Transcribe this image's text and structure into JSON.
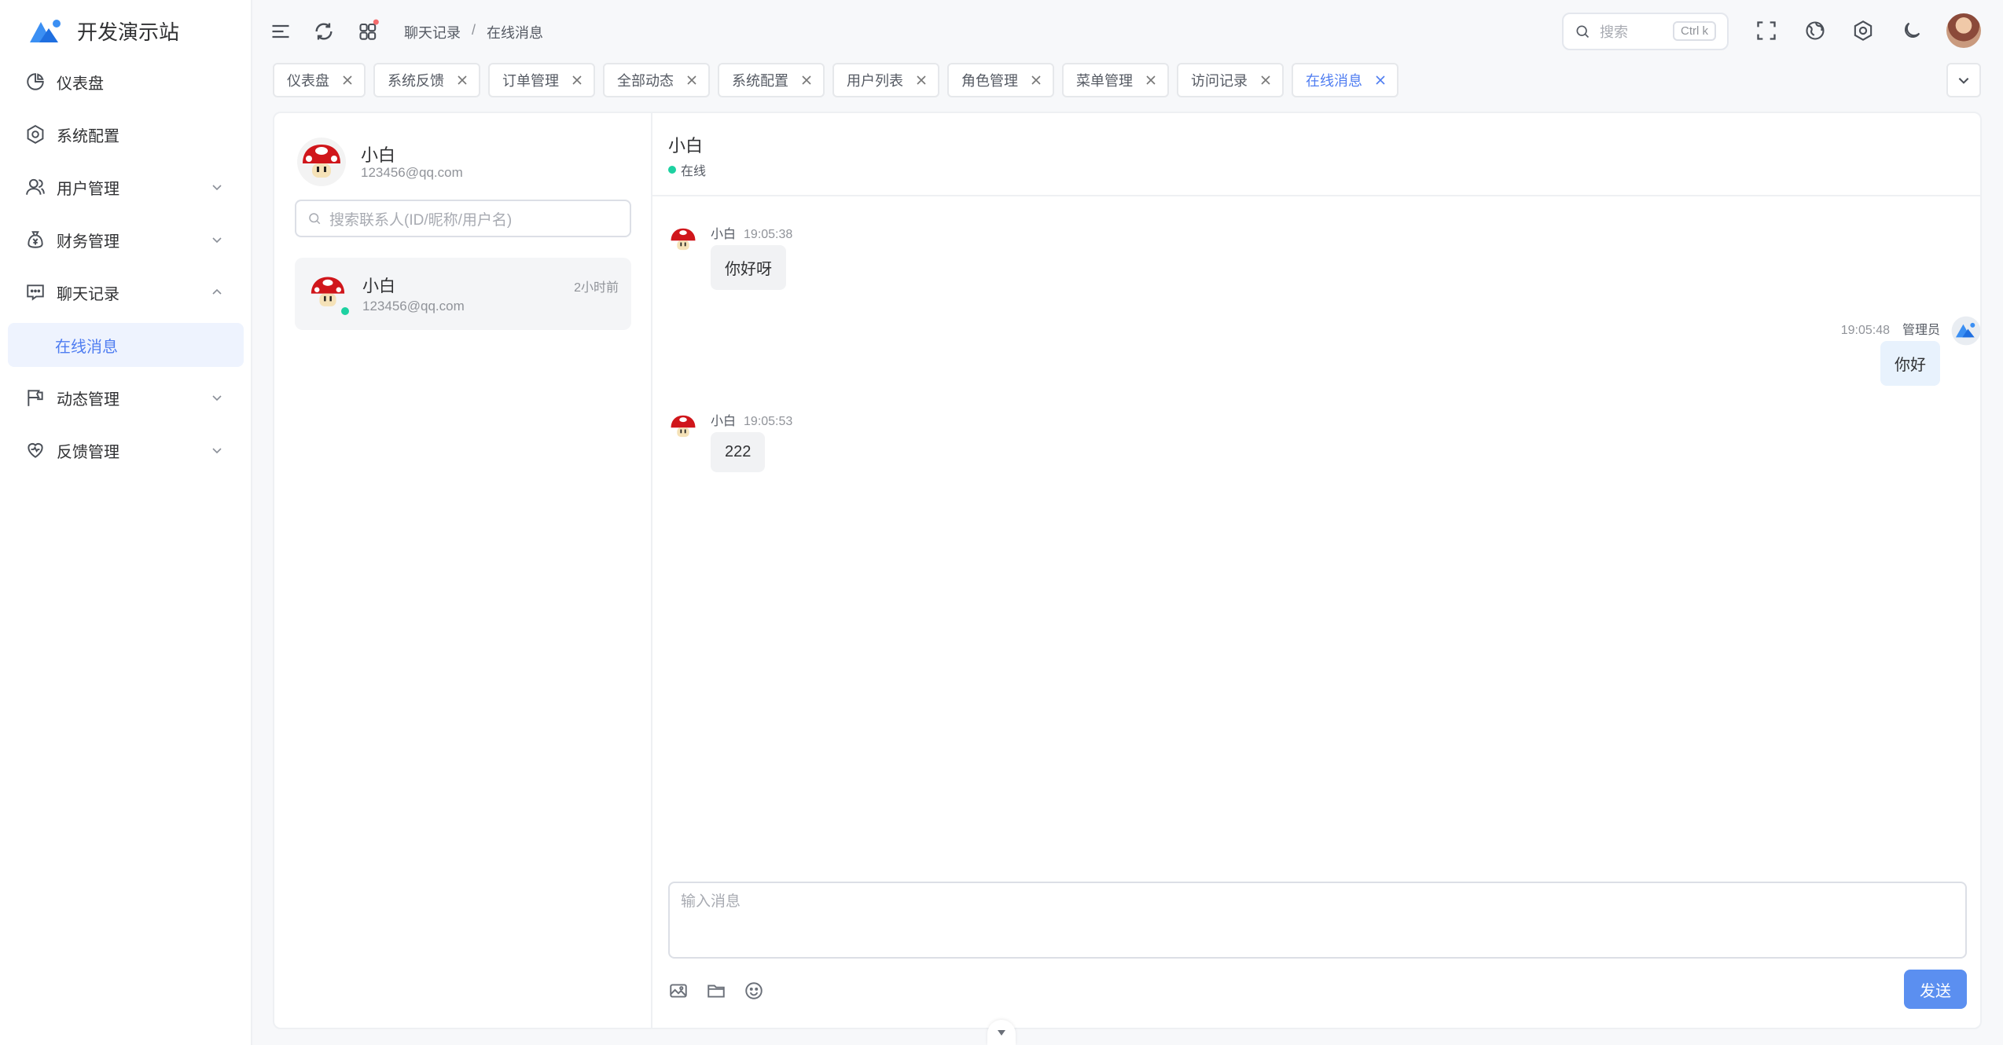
{
  "app": {
    "title": "开发演示站"
  },
  "sidebar": {
    "items": [
      {
        "label": "仪表盘",
        "icon": "pie-chart-icon"
      },
      {
        "label": "系统配置",
        "icon": "gear-icon"
      },
      {
        "label": "用户管理",
        "icon": "user-icon"
      },
      {
        "label": "财务管理",
        "icon": "money-bag-icon"
      },
      {
        "label": "聊天记录",
        "icon": "chat-icon"
      },
      {
        "label": "在线消息",
        "icon": ""
      },
      {
        "label": "动态管理",
        "icon": "flag-icon"
      },
      {
        "label": "反馈管理",
        "icon": "heart-icon"
      }
    ],
    "active_color": "#4f7df1"
  },
  "breadcrumb": [
    "聊天记录",
    "在线消息"
  ],
  "search": {
    "placeholder": "搜索",
    "shortcut": "Ctrl k"
  },
  "tabs": [
    "仪表盘",
    "系统反馈",
    "订单管理",
    "全部动态",
    "系统配置",
    "用户列表",
    "角色管理",
    "菜单管理",
    "访问记录",
    "在线消息"
  ],
  "me": {
    "name": "小白",
    "email": "123456@qq.com"
  },
  "contact_search": {
    "placeholder": "搜索联系人(ID/昵称/用户名)"
  },
  "contacts": [
    {
      "name": "小白",
      "email": "123456@qq.com",
      "time": "2小时前",
      "online": true
    }
  ],
  "chat": {
    "name": "小白",
    "status": "在线",
    "status_color": "#1dd1a1",
    "messages": [
      {
        "sender": "小白",
        "time": "19:05:38",
        "text": "你好呀",
        "side": "left"
      },
      {
        "sender": "管理员",
        "time": "19:05:48",
        "text": "你好",
        "side": "right"
      },
      {
        "sender": "小白",
        "time": "19:05:53",
        "text": "222",
        "side": "left"
      }
    ],
    "input_placeholder": "输入消息",
    "send_label": "发送",
    "send_color": "#5b8ff0"
  }
}
